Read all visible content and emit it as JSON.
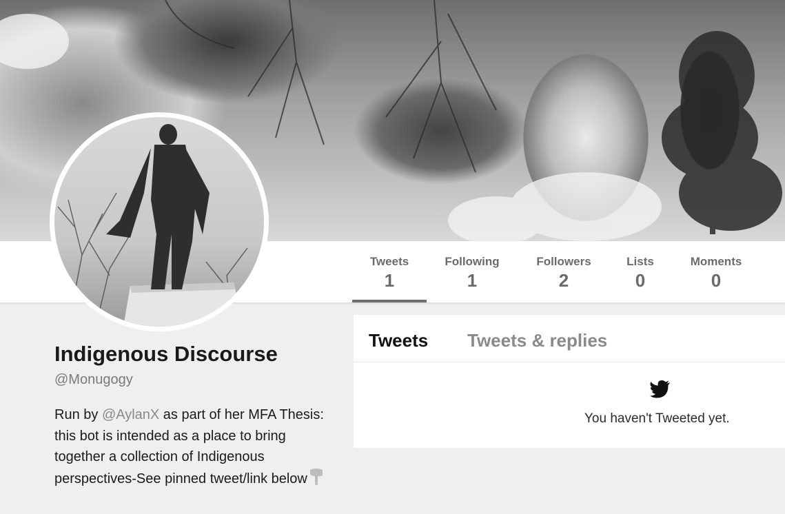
{
  "stats": [
    {
      "label": "Tweets",
      "value": "1"
    },
    {
      "label": "Following",
      "value": "1"
    },
    {
      "label": "Followers",
      "value": "2"
    },
    {
      "label": "Lists",
      "value": "0"
    },
    {
      "label": "Moments",
      "value": "0"
    }
  ],
  "profile": {
    "name": "Indigenous Discourse",
    "handle": "@Monugogy",
    "bio_before": "Run by ",
    "bio_mention": "@AylanX",
    "bio_after": " as part of her MFA Thesis: this bot is intended as a place to bring together a collection of Indigenous perspectives-See pinned tweet/link below"
  },
  "timeline": {
    "tabs": [
      "Tweets",
      "Tweets & replies"
    ],
    "empty_icon": "twitter-bird-icon",
    "empty_message": "You haven't Tweeted yet."
  },
  "icons": {
    "bio_emoji": "pointing-down-hand-icon"
  }
}
